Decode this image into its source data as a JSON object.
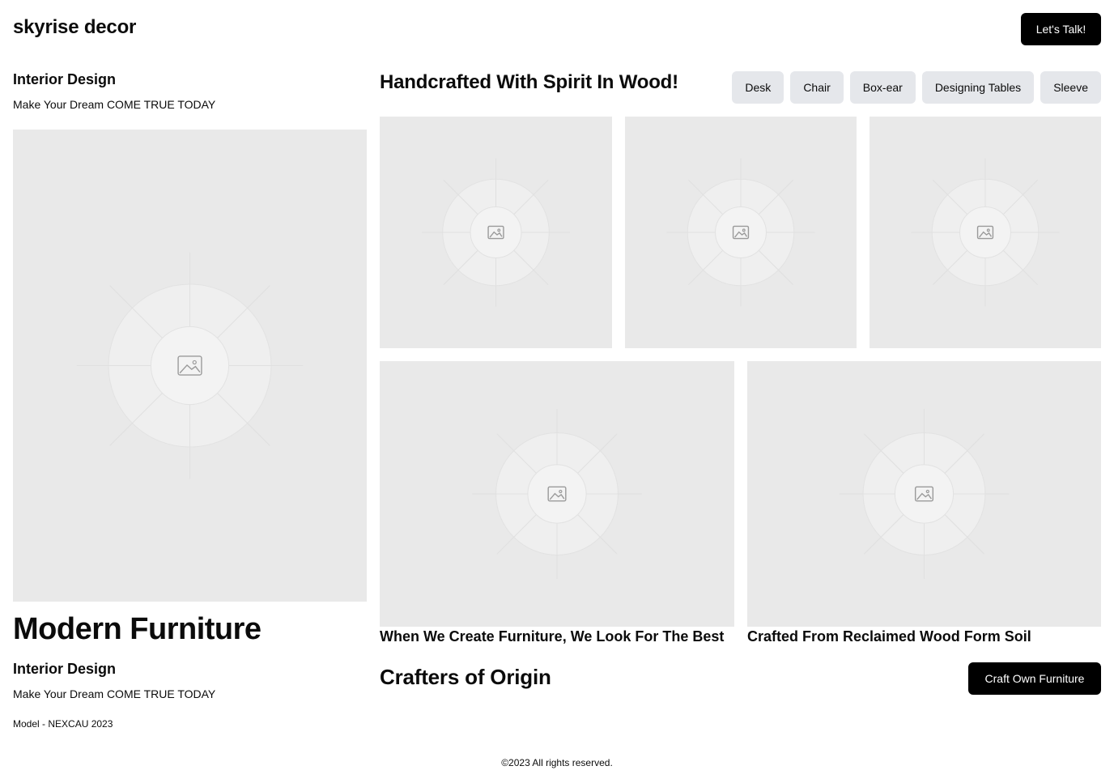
{
  "header": {
    "brand": "skyrise decor",
    "cta_label": "Let's Talk!"
  },
  "left": {
    "top_heading": "Interior Design",
    "top_tagline": "Make Your Dream COME TRUE TODAY",
    "hero_title": "Modern Furniture",
    "bottom_heading": "Interior Design",
    "bottom_tagline": "Make Your Dream COME TRUE TODAY",
    "model": "Model - NEXCAU 2023"
  },
  "gallery": {
    "title": "Handcrafted With Spirit In Wood!",
    "categories": [
      "Desk",
      "Chair",
      "Box-ear",
      "Designing Tables",
      "Sleeve"
    ],
    "captions": [
      "When We Create Furniture, We Look For The Best",
      "Crafted From Reclaimed Wood Form Soil"
    ]
  },
  "bottom": {
    "title": "Crafters of Origin",
    "cta_label": "Craft Own Furniture"
  },
  "footer": {
    "copyright": "©2023 All rights reserved."
  },
  "icons": {
    "placeholder": "image-icon"
  },
  "colors": {
    "primary": "#000000",
    "chip_bg": "#e5e7eb",
    "placeholder_bg": "#e9e9e9"
  }
}
